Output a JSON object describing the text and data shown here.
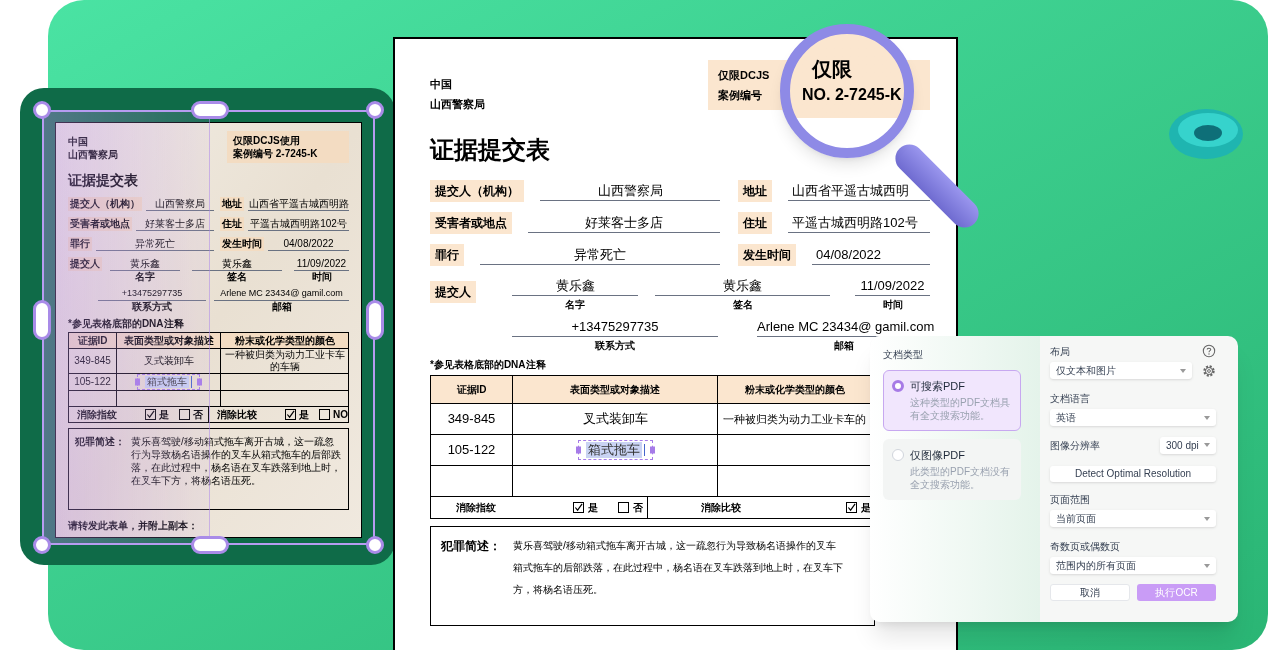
{
  "tablet_document": {
    "agency": [
      "中国",
      "山西警察局"
    ],
    "restricted_box": {
      "lines": [
        "仅限DCJS使用",
        "案例编号  2-7245-K"
      ]
    },
    "title": "证据提交表",
    "fields": [
      {
        "label": "提交人（机构）",
        "value": "山西警察局"
      },
      {
        "label": "地址",
        "value": "山西省平遥古城西明路"
      },
      {
        "label": "受害者或地点",
        "value": "好莱客士多店"
      },
      {
        "label": "住址",
        "value": "平遥古城西明路102号"
      },
      {
        "label": "罪行",
        "value": "异常死亡"
      },
      {
        "label": "发生时间",
        "value": "04/08/2022"
      }
    ],
    "submitter": {
      "label": "提交人",
      "entries": [
        {
          "value": "黄乐鑫",
          "caption": "名字"
        },
        {
          "value": "黄乐鑫",
          "caption": "签名"
        },
        {
          "value": "11/09/2022",
          "caption": "时间"
        }
      ]
    },
    "contacts": [
      {
        "value": "+13475297735",
        "caption": "联系方式"
      },
      {
        "value": "Arlene MC 23434@ gamil.com",
        "caption": "邮箱"
      }
    ],
    "note": "*参见表格底部的DNA注释",
    "table": {
      "columns": [
        "证据ID",
        "表面类型或对象描述",
        "粉末或化学类型的颜色"
      ],
      "rows": [
        {
          "id": "349-845",
          "description": "叉式装卸车",
          "color_note": "一种被归类为动力工业卡车的车辆",
          "editing": false
        },
        {
          "id": "105-122",
          "description": "箱式拖车",
          "editing": true
        }
      ]
    },
    "checks": [
      {
        "label": "消除指纹",
        "options": [
          {
            "label": "是",
            "checked": true
          },
          {
            "label": "否",
            "checked": false
          }
        ]
      },
      {
        "label": "消除比较",
        "options": [
          {
            "label": "是",
            "checked": true
          },
          {
            "label": "NO",
            "checked": false
          }
        ]
      }
    ],
    "summary": {
      "label": "犯罪简述：",
      "text": "黄乐喜驾驶/移动箱式拖车离开古城，这一疏忽行为导致杨名语操作的叉车从箱式拖车的后部跌落，在此过程中，杨名语在叉车跌落到地上时，在叉车下方，将杨名语压死。"
    },
    "footer": "请转发此表单，并附上副本："
  },
  "document": {
    "agency": [
      "中国",
      "山西警察局"
    ],
    "restricted_box": {
      "lines": [
        "仅限DCJS",
        "案例编号"
      ]
    },
    "title": "证据提交表",
    "fields": [
      {
        "label": "提交人（机构）",
        "value": "山西警察局"
      },
      {
        "label": "地址",
        "value": "山西省平遥古城西明"
      },
      {
        "label": "受害者或地点",
        "value": "好莱客士多店"
      },
      {
        "label": "住址",
        "value": "平遥古城西明路102号"
      },
      {
        "label": "罪行",
        "value": "异常死亡"
      },
      {
        "label": "发生时间",
        "value": "04/08/2022"
      }
    ],
    "submitter": {
      "label": "提交人",
      "entries": [
        {
          "value": "黄乐鑫",
          "caption": "名字"
        },
        {
          "value": "黄乐鑫",
          "caption": "签名"
        },
        {
          "value": "11/09/2022",
          "caption": "时间"
        }
      ]
    },
    "contacts": [
      {
        "value": "+13475297735",
        "caption": "联系方式"
      },
      {
        "value": "Arlene MC 23434@ gamil.com",
        "caption": "邮箱"
      }
    ],
    "note": "*参见表格底部的DNA注释",
    "table": {
      "columns": [
        "证据ID",
        "表面类型或对象描述",
        "粉末或化学类型的颜色"
      ],
      "rows": [
        {
          "id": "349-845",
          "description": "叉式装卸车",
          "color_note": "一种被归类为动力工业卡车的",
          "editing": false
        },
        {
          "id": "105-122",
          "description": "箱式拖车",
          "editing": true
        }
      ]
    },
    "checks": [
      {
        "label": "消除指纹",
        "options": [
          {
            "label": "是",
            "checked": true
          },
          {
            "label": "否",
            "checked": false
          }
        ]
      },
      {
        "label": "消除比较",
        "options": [
          {
            "label": "是",
            "checked": true
          }
        ]
      }
    ],
    "summary": {
      "label": "犯罪简述：",
      "lines": [
        "黄乐喜驾驶/移动箱式拖车离开古城，这一疏忽行为导致杨名语操作的叉车",
        "箱式拖车的后部跌落，在此过程中，杨名语在叉车跌落到地上时，在叉车下",
        "方，将杨名语压死。"
      ]
    }
  },
  "magnifier": {
    "lens_text": [
      "仅限",
      "NO. 2-7245-K"
    ]
  },
  "ocr_panel": {
    "doc_type": {
      "label": "文档类型",
      "options": [
        {
          "title": "可搜索PDF",
          "description": "这种类型的PDF文档具有全文搜索功能。",
          "selected": true
        },
        {
          "title": "仅图像PDF",
          "description": "此类型的PDF文档没有全文搜索功能。",
          "selected": false
        }
      ]
    },
    "settings": [
      {
        "kind": "select",
        "label": "布局",
        "value": "仅文本和图片",
        "tools": true
      },
      {
        "kind": "select",
        "label": "文档语言",
        "value": "英语"
      },
      {
        "kind": "inline_select",
        "label": "图像分辨率",
        "value": "300 dpi"
      },
      {
        "kind": "button",
        "label": "Detect Optimal Resolution"
      },
      {
        "kind": "select",
        "label": "页面范围",
        "value": "当前页面"
      },
      {
        "kind": "select",
        "label": "奇数页或偶数页",
        "value": "范围内的所有页面"
      }
    ],
    "buttons": [
      {
        "label": "取消",
        "kind": "secondary"
      },
      {
        "label": "执行OCR",
        "kind": "primary"
      }
    ]
  }
}
